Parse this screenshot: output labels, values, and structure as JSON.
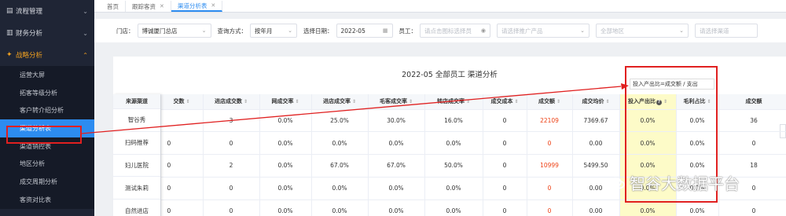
{
  "sidebar": {
    "top_items": [
      {
        "label": "流程管理",
        "icon": "flow-icon"
      },
      {
        "label": "财务分析",
        "icon": "chart-icon"
      },
      {
        "label": "战略分析",
        "icon": "strategy-icon"
      }
    ],
    "sub_items": [
      "运营大屏",
      "拓客等级分析",
      "客户转介绍分析",
      "渠道分析表",
      "渠道销控表",
      "地区分析",
      "成交周期分析",
      "客资对比表"
    ]
  },
  "tabs": [
    {
      "label": "首页"
    },
    {
      "label": "跟踪客资"
    },
    {
      "label": "渠道分析表"
    }
  ],
  "filters": {
    "store_label": "门店：",
    "store_value": "博诚厦门总店",
    "query_label": "查询方式：",
    "query_value": "按年月",
    "date_label": "选择日期：",
    "date_value": "2022-05",
    "employee_label": "员工：",
    "employee_placeholder": "请点击图标选择员",
    "product_placeholder": "请选择推广产品",
    "region_placeholder": "全部地区",
    "channel_placeholder": "请选择渠道"
  },
  "report": {
    "title": "2022-05 全部员工 渠道分析",
    "tooltip": "投入产出比=成交额 / 支出",
    "columns": [
      "来源渠道",
      "交数",
      "进店成交数",
      "网成交率",
      "进店成交率",
      "毛客成交率",
      "转店成交率",
      "成交成本",
      "成交额",
      "成交均价",
      "投入产出比",
      "毛利占比",
      "成交额"
    ],
    "rows": [
      {
        "channel": "智谷秀",
        "deals": "",
        "store_deals": "3",
        "net_rate": "0.0%",
        "store_rate": "25.0%",
        "gross_rate": "30.0%",
        "transfer_rate": "16.0%",
        "cost": "0",
        "amount": "22109",
        "avg": "7369.67",
        "roi": "0.0%",
        "margin": "0.0%",
        "extra": "36"
      },
      {
        "channel": "扫码推荐",
        "deals": "0",
        "store_deals": "0",
        "net_rate": "0.0%",
        "store_rate": "0.0%",
        "gross_rate": "0.0%",
        "transfer_rate": "0.0%",
        "cost": "0",
        "amount": "0",
        "avg": "0.00",
        "roi": "0.0%",
        "margin": "0.0%",
        "extra": "0"
      },
      {
        "channel": "妇儿医院",
        "deals": "0",
        "store_deals": "2",
        "net_rate": "0.0%",
        "store_rate": "67.0%",
        "gross_rate": "67.0%",
        "transfer_rate": "50.0%",
        "cost": "0",
        "amount": "10999",
        "avg": "5499.50",
        "roi": "0.0%",
        "margin": "0.0%",
        "extra": "18"
      },
      {
        "channel": "测试朱莉",
        "deals": "0",
        "store_deals": "0",
        "net_rate": "0.0%",
        "store_rate": "0.0%",
        "gross_rate": "0.0%",
        "transfer_rate": "0.0%",
        "cost": "0",
        "amount": "0",
        "avg": "0.00",
        "roi": "0.0%",
        "margin": "0.0%",
        "extra": "0"
      },
      {
        "channel": "自然进店",
        "deals": "0",
        "store_deals": "0",
        "net_rate": "0.0%",
        "store_rate": "0.0%",
        "gross_rate": "0.0%",
        "transfer_rate": "0.0%",
        "cost": "0",
        "amount": "0",
        "avg": "0.00",
        "roi": "0.0%",
        "margin": "0.0%",
        "extra": "0"
      }
    ]
  },
  "watermark": "智谷大数据平台",
  "colors": {
    "sidebar_bg": "#1f2535",
    "accent": "#2d8cf0",
    "highlight": "#fdfbc8",
    "annotation": "#e02020",
    "amount_red": "#ed4014"
  }
}
